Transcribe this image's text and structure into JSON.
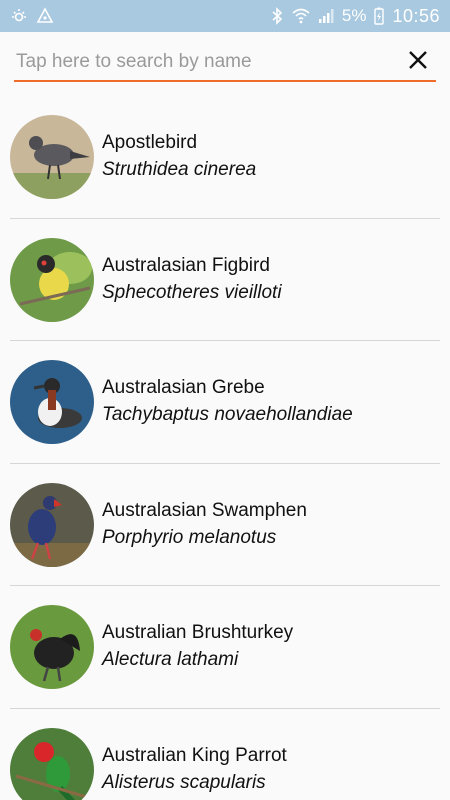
{
  "status_bar": {
    "battery_percent": "5%",
    "time": "10:56",
    "icons": [
      "sun-icon",
      "drive-icon",
      "bluetooth-icon",
      "wifi-icon",
      "signal-icon",
      "battery-charging-icon"
    ]
  },
  "search": {
    "placeholder": "Tap here to search by name",
    "value": ""
  },
  "colors": {
    "accent": "#ef6c2a",
    "status_bar_bg": "#a9c9e0"
  },
  "birds": [
    {
      "common": "Apostlebird",
      "scientific": "Struthidea cinerea"
    },
    {
      "common": "Australasian Figbird",
      "scientific": "Sphecotheres vieilloti"
    },
    {
      "common": "Australasian Grebe",
      "scientific": "Tachybaptus novaehollandiae"
    },
    {
      "common": "Australasian Swamphen",
      "scientific": "Porphyrio melanotus"
    },
    {
      "common": "Australian Brushturkey",
      "scientific": "Alectura lathami"
    },
    {
      "common": "Australian King Parrot",
      "scientific": "Alisterus scapularis"
    }
  ]
}
